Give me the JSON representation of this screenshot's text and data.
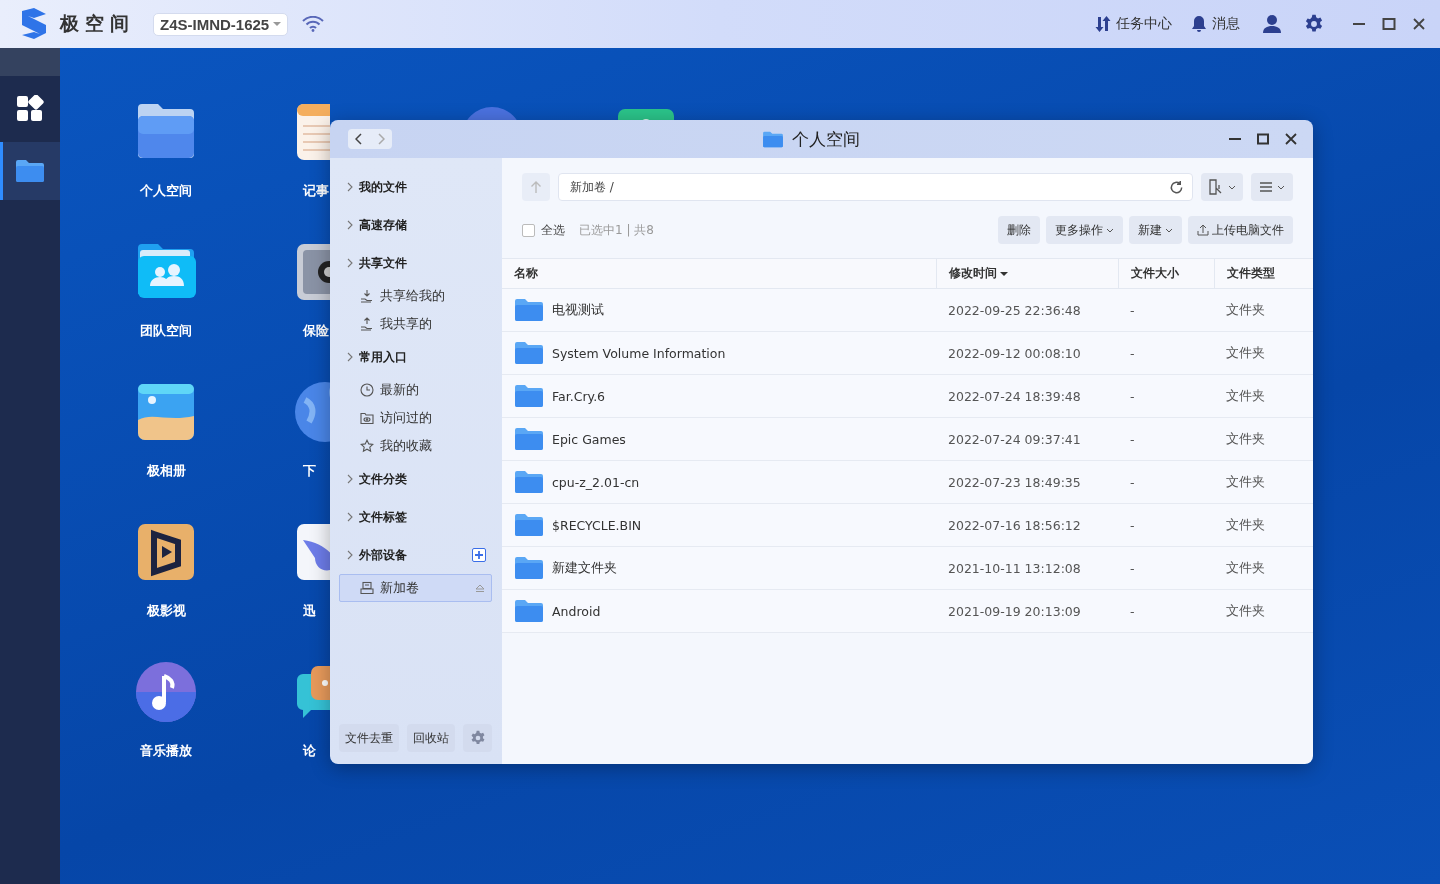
{
  "topbar": {
    "brand": "极空间",
    "device": "Z4S-IMND-1625",
    "actions": [
      {
        "kind": "transfer",
        "label": "任务中心"
      },
      {
        "kind": "bell",
        "label": "消息"
      },
      {
        "kind": "user"
      },
      {
        "kind": "gear"
      }
    ]
  },
  "dock": [
    {
      "kind": "apps",
      "selected": false
    },
    {
      "kind": "folder",
      "selected": true
    }
  ],
  "desktop": {
    "columns": [
      [
        {
          "kind": "folder",
          "label": "个人空间"
        },
        {
          "kind": "team",
          "label": "团队空间"
        },
        {
          "kind": "photos",
          "label": "极相册"
        },
        {
          "kind": "video",
          "label": "极影视"
        },
        {
          "kind": "music",
          "label": "音乐播放"
        }
      ],
      [
        {
          "kind": "notes",
          "label": "记事"
        },
        {
          "kind": "safe",
          "label": "保险"
        },
        {
          "kind": "globe",
          "label": "下"
        },
        {
          "kind": "bird",
          "label": "迅"
        },
        {
          "kind": "chat",
          "label": "论"
        }
      ]
    ],
    "background_icons": [
      {
        "kind": "orb"
      },
      {
        "kind": "card"
      }
    ]
  },
  "window": {
    "title": "个人空间",
    "sidebar": {
      "groups": [
        {
          "label": "我的文件"
        },
        {
          "label": "高速存储"
        },
        {
          "label": "共享文件",
          "children": [
            {
              "label": "共享给我的",
              "kind": "share-in",
              "selected": false
            },
            {
              "label": "我共享的",
              "kind": "share-out",
              "selected": false
            }
          ]
        },
        {
          "label": "常用入口",
          "children": [
            {
              "label": "最新的",
              "kind": "clock",
              "selected": false
            },
            {
              "label": "访问过的",
              "kind": "eye-folder",
              "selected": false
            },
            {
              "label": "我的收藏",
              "kind": "star",
              "selected": false
            }
          ]
        },
        {
          "label": "文件分类"
        },
        {
          "label": "文件标签"
        },
        {
          "label": "外部设备",
          "add_button": true,
          "children": [
            {
              "label": "新加卷",
              "kind": "drive",
              "selected": true,
              "ejectable": true
            }
          ]
        }
      ],
      "footer_buttons": [
        "文件去重",
        "回收站"
      ]
    },
    "path": "新加卷 /",
    "select_all": {
      "label": "全选",
      "checked": false
    },
    "selection_status": "已选中1 | 共8",
    "actions": [
      {
        "label": "删除",
        "kind": "plain"
      },
      {
        "label": "更多操作",
        "kind": "dropdown"
      },
      {
        "label": "新建",
        "kind": "dropdown"
      },
      {
        "label": "上传电脑文件",
        "kind": "upload"
      }
    ],
    "table": {
      "columns": [
        {
          "label": "名称",
          "sorted": false
        },
        {
          "label": "修改时间",
          "sorted": true
        },
        {
          "label": "文件大小",
          "sorted": false
        },
        {
          "label": "文件类型",
          "sorted": false
        }
      ],
      "rows": [
        {
          "name": "电视测试",
          "modified": "2022-09-25 22:36:48",
          "size": "-",
          "type": "文件夹"
        },
        {
          "name": "System Volume Information",
          "modified": "2022-09-12 00:08:10",
          "size": "-",
          "type": "文件夹"
        },
        {
          "name": "Far.Cry.6",
          "modified": "2022-07-24 18:39:48",
          "size": "-",
          "type": "文件夹"
        },
        {
          "name": "Epic Games",
          "modified": "2022-07-24 09:37:41",
          "size": "-",
          "type": "文件夹"
        },
        {
          "name": "cpu-z_2.01-cn",
          "modified": "2022-07-23 18:49:35",
          "size": "-",
          "type": "文件夹"
        },
        {
          "name": "$RECYCLE.BIN",
          "modified": "2022-07-16 18:56:12",
          "size": "-",
          "type": "文件夹"
        },
        {
          "name": "新建文件夹",
          "modified": "2021-10-11 13:12:08",
          "size": "-",
          "type": "文件夹"
        },
        {
          "name": "Android",
          "modified": "2021-09-19 20:13:09",
          "size": "-",
          "type": "文件夹"
        }
      ]
    }
  }
}
